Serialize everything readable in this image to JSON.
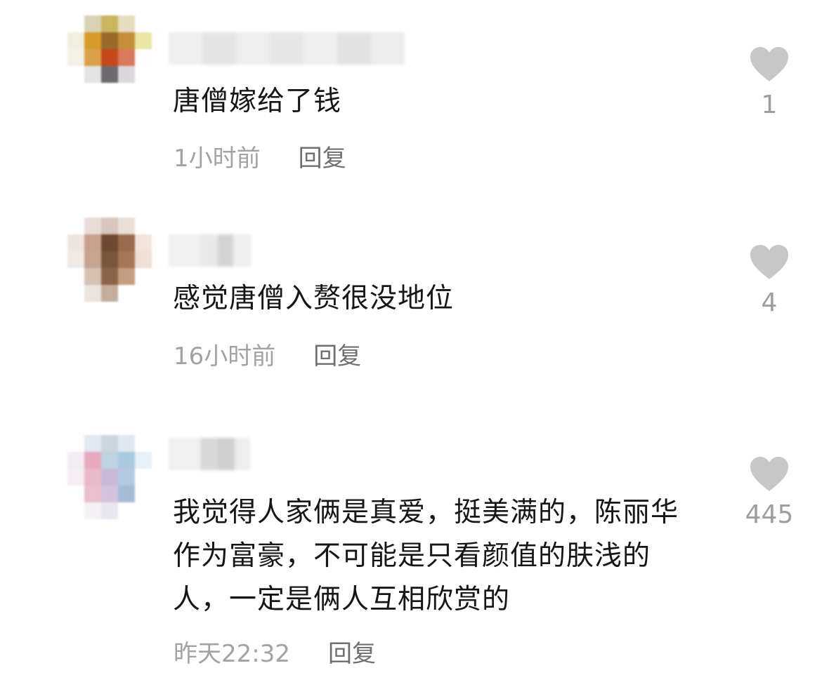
{
  "colors": {
    "heart": "#c7c7c7",
    "comment_text": "#161616",
    "timestamp": "#a3a3a3",
    "reply": "#6f6f6f",
    "count": "#9e9e9e"
  },
  "icons": {
    "like": "heart-icon"
  },
  "comments": [
    {
      "text": "唐僧嫁给了钱",
      "timestamp": "1小时前",
      "reply_label": "回复",
      "like_count": "1"
    },
    {
      "text": "感觉唐僧入赘很没地位",
      "timestamp": "16小时前",
      "reply_label": "回复",
      "like_count": "4"
    },
    {
      "text": "我觉得人家俩是真爱，挺美满的，陈丽华作为富豪，不可能是只看颜值的肤浅的人，一定是俩人互相欣赏的",
      "timestamp": "昨天22:32",
      "reply_label": "回复",
      "like_count": "445"
    }
  ]
}
